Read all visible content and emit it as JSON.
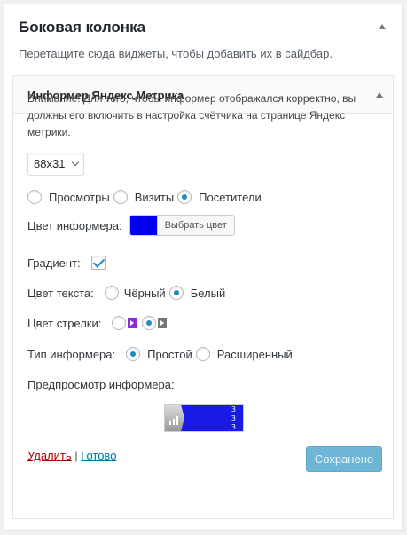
{
  "sidebar": {
    "title": "Боковая колонка",
    "description": "Перетащите сюда виджеты, чтобы добавить их в сайдбар."
  },
  "widget": {
    "title": "Информер Яндекс.Метрика",
    "notice": "Внимание! Для того, чтобы информер отображался корректно, вы должны его включить в настройка счётчика на странице Яндекс метрики.",
    "size_select": {
      "selected": "88x31"
    },
    "data_type": {
      "options": [
        "Просмотры",
        "Визиты",
        "Посетители"
      ],
      "selected": "Посетители"
    },
    "informer_color": {
      "label": "Цвет информера:",
      "value": "#0000ee",
      "button_label": "Выбрать цвет"
    },
    "gradient": {
      "label": "Градиент:",
      "checked": true
    },
    "text_color": {
      "label": "Цвет текста:",
      "options": [
        "Чёрный",
        "Белый"
      ],
      "selected": "Белый"
    },
    "arrow_color": {
      "label": "Цвет стрелки:",
      "options": [
        "purple-arrow-icon",
        "gray-arrow-icon"
      ],
      "selected": "gray-arrow-icon"
    },
    "informer_type": {
      "label": "Тип информера:",
      "options": [
        "Простой",
        "Расширенный"
      ],
      "selected": "Простой"
    },
    "preview": {
      "label": "Предпросмотр информера:",
      "lines": [
        "3",
        "3",
        "3"
      ]
    },
    "footer": {
      "delete_label": "Удалить",
      "separator": "|",
      "done_label": "Готово",
      "saved_label": "Сохранено"
    }
  }
}
